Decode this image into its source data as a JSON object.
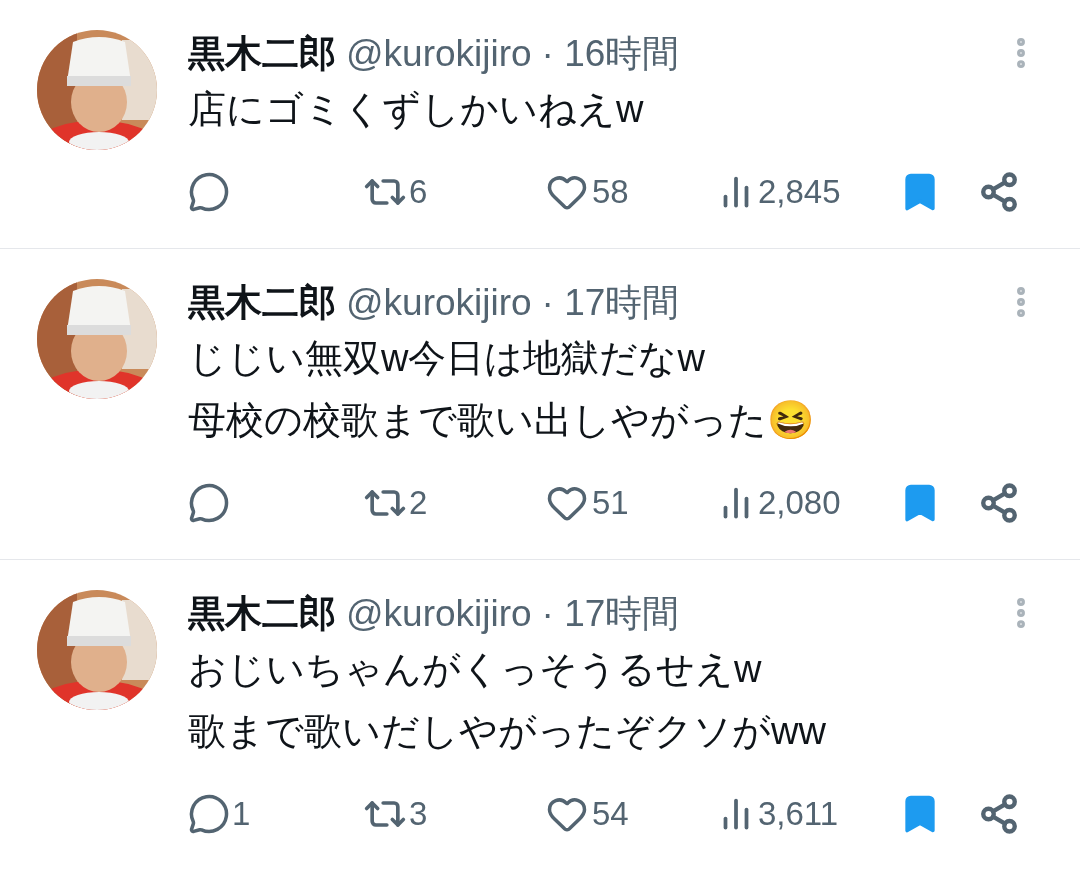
{
  "tweets": [
    {
      "name": "黒木二郎",
      "handle": "@kurokijiro",
      "time": "· 16時間",
      "lines": [
        "店にゴミくずしかいねえw"
      ],
      "retweets": "6",
      "likes": "58",
      "views": "2,845",
      "bookmarked": true
    },
    {
      "name": "黒木二郎",
      "handle": "@kurokijiro",
      "time": "· 17時間",
      "lines": [
        "じじい無双w今日は地獄だなw",
        "母校の校歌まで歌い出しやがった😆"
      ],
      "retweets": "2",
      "likes": "51",
      "views": "2,080",
      "bookmarked": true
    },
    {
      "name": "黒木二郎",
      "handle": "@kurokijiro",
      "time": "· 17時間",
      "lines": [
        "おじいちゃんがくっそうるせえw",
        "歌まで歌いだしやがったぞクソがww"
      ],
      "replies": "1",
      "retweets": "3",
      "likes": "54",
      "views": "3,611",
      "bookmarked": true
    }
  ]
}
